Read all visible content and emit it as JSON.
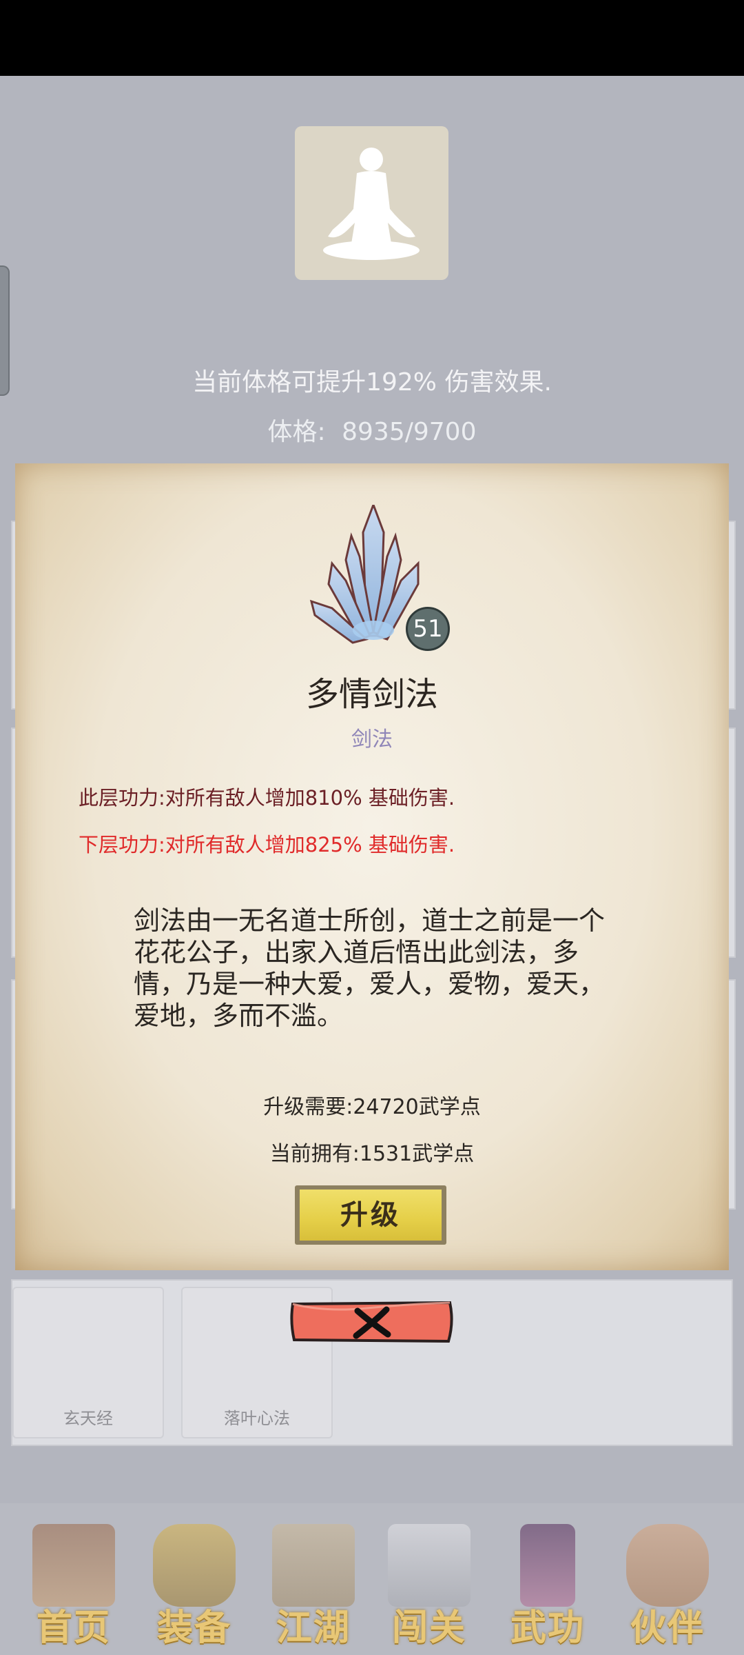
{
  "stats": {
    "effect_text": "当前体格可提升192% 伤害效果.",
    "physique_label": "体格:",
    "physique_value": "8935/9700"
  },
  "skill": {
    "name": "多情剑法",
    "type": "剑法",
    "level": "51",
    "current_effect": "此层功力:对所有敌人增加810% 基础伤害.",
    "next_effect": "下层功力:对所有敌人增加825% 基础伤害.",
    "description": "剑法由一无名道士所创，道士之前是一个花花公子，出家入道后悟出此剑法，多情，乃是一种大爱，爱人，爱物，爱天，爱地，多而不滥。",
    "upgrade_cost": "升级需要:24720武学点",
    "current_points": "当前拥有:1531武学点",
    "upgrade_label": "升级"
  },
  "background_cards": [
    {
      "label": "玄天经"
    },
    {
      "label": "落叶心法"
    }
  ],
  "nav": {
    "items": [
      {
        "label": "首页",
        "icon": "palace-icon"
      },
      {
        "label": "装备",
        "icon": "armor-icon"
      },
      {
        "label": "江湖",
        "icon": "scroll-map-icon"
      },
      {
        "label": "闯关",
        "icon": "crossed-swords-icon"
      },
      {
        "label": "武功",
        "icon": "book-icon"
      },
      {
        "label": "伙伴",
        "icon": "partners-icon"
      }
    ]
  },
  "colors": {
    "next_effect": "#e02a2a",
    "current_effect": "#6b1f25",
    "skill_type": "#8f86b8",
    "close_button": "#ee6e5d",
    "upgrade_button": "#e5cf48"
  }
}
